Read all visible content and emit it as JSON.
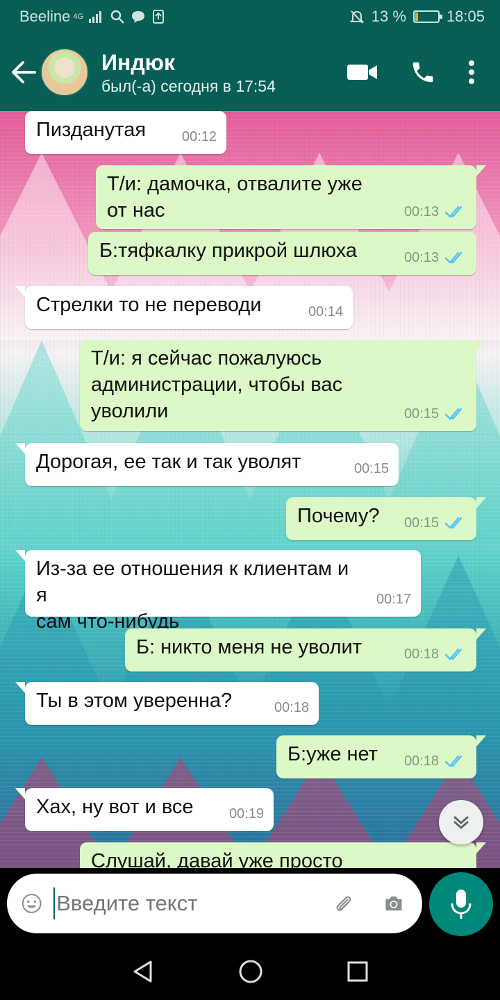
{
  "status_bar": {
    "carrier": "Beeline",
    "network": "4G",
    "battery": "13 %",
    "battery_level": 0.13,
    "time": "18:05"
  },
  "header": {
    "contact_name": "Индюк",
    "contact_status": "был(-а) сегодня в 17:54",
    "icons": [
      "back-arrow-icon",
      "video-call-icon",
      "phone-icon",
      "more-options-icon"
    ]
  },
  "messages": [
    {
      "dir": "in",
      "text": "Пизданутая",
      "time": "00:12"
    },
    {
      "dir": "out",
      "text": "Т/и: дамочка, отвалите уже от нас",
      "time": "00:13"
    },
    {
      "dir": "out",
      "text": "Б:тяфкалку прикрой шлюха",
      "time": "00:13"
    },
    {
      "dir": "in",
      "text": "Стрелки то не переводи",
      "time": "00:14"
    },
    {
      "dir": "out",
      "text": "Т/и: я сейчас пожалуюсь\nадминистрации, чтобы вас\nуволили",
      "time": "00:15"
    },
    {
      "dir": "in",
      "text": "Дорогая, ее так и так уволят",
      "time": "00:15"
    },
    {
      "dir": "out",
      "text": "Почему?",
      "time": "00:15"
    },
    {
      "dir": "in",
      "text": "Из-за ее отношения к клиентам и я\nсам что-нибудь",
      "time": "00:17"
    },
    {
      "dir": "out",
      "text": "Б: никто меня не уволит",
      "time": "00:18"
    },
    {
      "dir": "in",
      "text": "Ты в этом уверенна?",
      "time": "00:18"
    },
    {
      "dir": "out",
      "text": "Б:уже нет",
      "time": "00:18"
    },
    {
      "dir": "in",
      "text": "Хах, ну вот и все",
      "time": "00:19"
    },
    {
      "dir": "out",
      "text": "Слушай, давай уже просто уйдём",
      "time": ""
    }
  ],
  "input": {
    "placeholder": "Введите текст"
  },
  "colors": {
    "header": "#075E54",
    "outgoing_bubble": "#DCF8C6",
    "incoming_bubble": "#FFFFFF",
    "read_ticks": "#4FC3F7",
    "mic_button": "#00897B"
  }
}
